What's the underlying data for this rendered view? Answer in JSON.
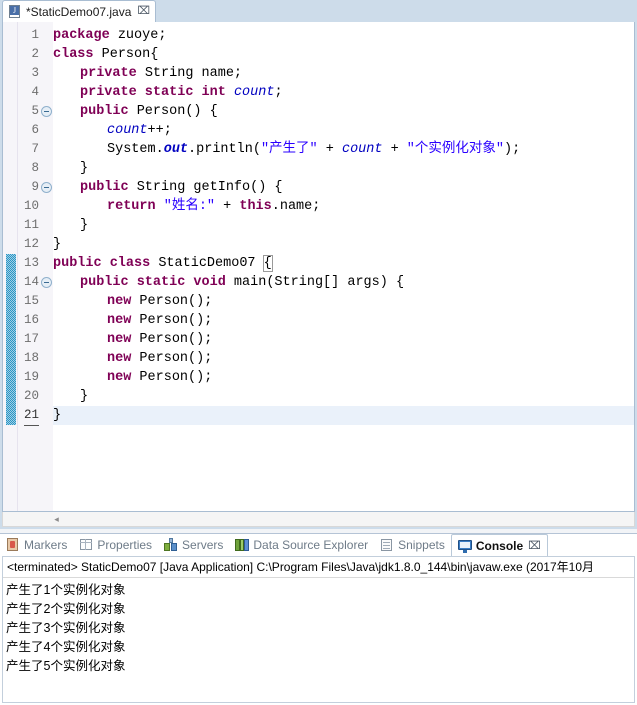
{
  "editor": {
    "tab": {
      "icon": "java-file-icon",
      "label": "*StaticDemo07.java",
      "close": "⌧"
    },
    "current_line": 21,
    "changed_lines": {
      "from": 13,
      "to": 21
    },
    "fold_lines": [
      5,
      9,
      14
    ],
    "lines": [
      {
        "n": 1,
        "indent": 0,
        "tokens": [
          {
            "t": "kw",
            "v": "package"
          },
          {
            "t": "pln",
            "v": " zuoye;"
          }
        ]
      },
      {
        "n": 2,
        "indent": 0,
        "tokens": [
          {
            "t": "kw",
            "v": "class"
          },
          {
            "t": "pln",
            "v": " Person{"
          }
        ]
      },
      {
        "n": 3,
        "indent": 1,
        "tokens": [
          {
            "t": "kw",
            "v": "private"
          },
          {
            "t": "pln",
            "v": " String name;"
          }
        ]
      },
      {
        "n": 4,
        "indent": 1,
        "tokens": [
          {
            "t": "kw",
            "v": "private static int"
          },
          {
            "t": "pln",
            "v": " "
          },
          {
            "t": "fld",
            "v": "count"
          },
          {
            "t": "pln",
            "v": ";"
          }
        ]
      },
      {
        "n": 5,
        "indent": 1,
        "tokens": [
          {
            "t": "kw",
            "v": "public"
          },
          {
            "t": "pln",
            "v": " Person() {"
          }
        ]
      },
      {
        "n": 6,
        "indent": 2,
        "tokens": [
          {
            "t": "fld",
            "v": "count"
          },
          {
            "t": "pln",
            "v": "++;"
          }
        ]
      },
      {
        "n": 7,
        "indent": 2,
        "tokens": [
          {
            "t": "pln",
            "v": "System."
          },
          {
            "t": "fldb",
            "v": "out"
          },
          {
            "t": "pln",
            "v": ".println("
          },
          {
            "t": "str",
            "v": "\"产生了\""
          },
          {
            "t": "pln",
            "v": " + "
          },
          {
            "t": "fld",
            "v": "count"
          },
          {
            "t": "pln",
            "v": " + "
          },
          {
            "t": "str",
            "v": "\"个实例化对象\""
          },
          {
            "t": "pln",
            "v": ");"
          }
        ]
      },
      {
        "n": 8,
        "indent": 1,
        "tokens": [
          {
            "t": "pln",
            "v": "}"
          }
        ]
      },
      {
        "n": 9,
        "indent": 1,
        "tokens": [
          {
            "t": "kw",
            "v": "public"
          },
          {
            "t": "pln",
            "v": " String getInfo() {"
          }
        ]
      },
      {
        "n": 10,
        "indent": 2,
        "tokens": [
          {
            "t": "kw",
            "v": "return"
          },
          {
            "t": "pln",
            "v": " "
          },
          {
            "t": "str",
            "v": "\"姓名:\""
          },
          {
            "t": "pln",
            "v": " + "
          },
          {
            "t": "kw",
            "v": "this"
          },
          {
            "t": "pln",
            "v": ".name;"
          }
        ]
      },
      {
        "n": 11,
        "indent": 1,
        "tokens": [
          {
            "t": "pln",
            "v": "}"
          }
        ]
      },
      {
        "n": 12,
        "indent": 0,
        "tokens": [
          {
            "t": "pln",
            "v": "}"
          }
        ]
      },
      {
        "n": 13,
        "indent": 0,
        "tokens": [
          {
            "t": "kw",
            "v": "public class"
          },
          {
            "t": "pln",
            "v": " StaticDemo07 "
          },
          {
            "t": "brkm",
            "v": "{"
          }
        ]
      },
      {
        "n": 14,
        "indent": 1,
        "tokens": [
          {
            "t": "kw",
            "v": "public static void"
          },
          {
            "t": "pln",
            "v": " main(String[] args) {"
          }
        ]
      },
      {
        "n": 15,
        "indent": 2,
        "tokens": [
          {
            "t": "kw",
            "v": "new"
          },
          {
            "t": "pln",
            "v": " Person();"
          }
        ]
      },
      {
        "n": 16,
        "indent": 2,
        "tokens": [
          {
            "t": "kw",
            "v": "new"
          },
          {
            "t": "pln",
            "v": " Person();"
          }
        ]
      },
      {
        "n": 17,
        "indent": 2,
        "tokens": [
          {
            "t": "kw",
            "v": "new"
          },
          {
            "t": "pln",
            "v": " Person();"
          }
        ]
      },
      {
        "n": 18,
        "indent": 2,
        "tokens": [
          {
            "t": "kw",
            "v": "new"
          },
          {
            "t": "pln",
            "v": " Person();"
          }
        ]
      },
      {
        "n": 19,
        "indent": 2,
        "tokens": [
          {
            "t": "kw",
            "v": "new"
          },
          {
            "t": "pln",
            "v": " Person();"
          }
        ]
      },
      {
        "n": 20,
        "indent": 1,
        "tokens": [
          {
            "t": "pln",
            "v": "}"
          }
        ]
      },
      {
        "n": 21,
        "indent": 0,
        "tokens": [
          {
            "t": "pln",
            "v": "}"
          }
        ]
      }
    ],
    "hscroll_arrow": "◂"
  },
  "bottom_panel": {
    "tabs": [
      {
        "icon": "markers-icon",
        "label": "Markers",
        "active": false
      },
      {
        "icon": "properties-icon",
        "label": "Properties",
        "active": false
      },
      {
        "icon": "servers-icon",
        "label": "Servers",
        "active": false
      },
      {
        "icon": "data-source-explorer-icon",
        "label": "Data Source Explorer",
        "active": false
      },
      {
        "icon": "snippets-icon",
        "label": "Snippets",
        "active": false
      },
      {
        "icon": "console-icon",
        "label": "Console",
        "active": true,
        "close": "⌧"
      }
    ],
    "console": {
      "status": "<terminated> StaticDemo07 [Java Application] C:\\Program Files\\Java\\jdk1.8.0_144\\bin\\javaw.exe (2017年10月",
      "output": [
        "产生了1个实例化对象",
        "产生了2个实例化对象",
        "产生了3个实例化对象",
        "产生了4个实例化对象",
        "产生了5个实例化对象"
      ]
    }
  },
  "colors": {
    "keyword": "#7F0055",
    "string": "#2A00FF",
    "field": "#0000C0",
    "tabstrip": "#CDDCEA",
    "current_line": "#EAF1FA",
    "change_bar": "#2A95C5"
  }
}
